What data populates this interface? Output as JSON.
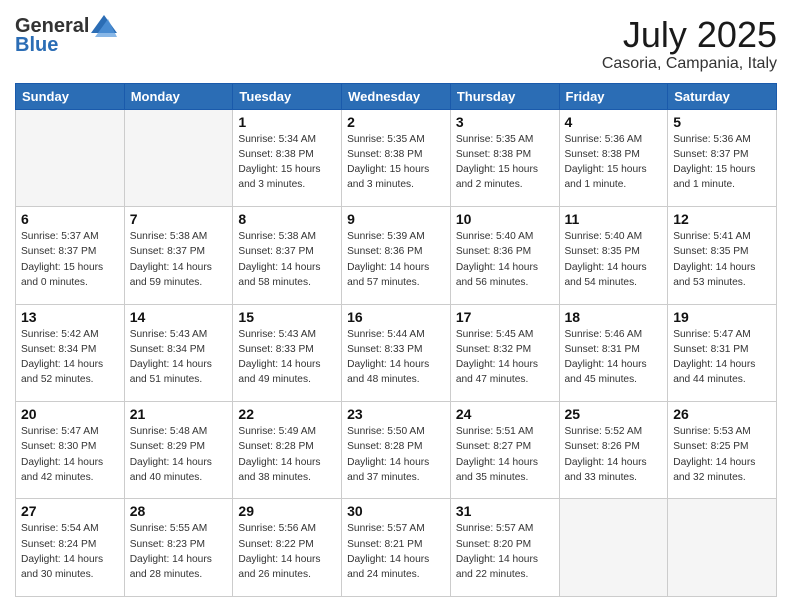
{
  "header": {
    "logo_general": "General",
    "logo_blue": "Blue",
    "month": "July 2025",
    "location": "Casoria, Campania, Italy"
  },
  "days_of_week": [
    "Sunday",
    "Monday",
    "Tuesday",
    "Wednesday",
    "Thursday",
    "Friday",
    "Saturday"
  ],
  "weeks": [
    [
      {
        "day": "",
        "info": ""
      },
      {
        "day": "",
        "info": ""
      },
      {
        "day": "1",
        "info": "Sunrise: 5:34 AM\nSunset: 8:38 PM\nDaylight: 15 hours\nand 3 minutes."
      },
      {
        "day": "2",
        "info": "Sunrise: 5:35 AM\nSunset: 8:38 PM\nDaylight: 15 hours\nand 3 minutes."
      },
      {
        "day": "3",
        "info": "Sunrise: 5:35 AM\nSunset: 8:38 PM\nDaylight: 15 hours\nand 2 minutes."
      },
      {
        "day": "4",
        "info": "Sunrise: 5:36 AM\nSunset: 8:38 PM\nDaylight: 15 hours\nand 1 minute."
      },
      {
        "day": "5",
        "info": "Sunrise: 5:36 AM\nSunset: 8:37 PM\nDaylight: 15 hours\nand 1 minute."
      }
    ],
    [
      {
        "day": "6",
        "info": "Sunrise: 5:37 AM\nSunset: 8:37 PM\nDaylight: 15 hours\nand 0 minutes."
      },
      {
        "day": "7",
        "info": "Sunrise: 5:38 AM\nSunset: 8:37 PM\nDaylight: 14 hours\nand 59 minutes."
      },
      {
        "day": "8",
        "info": "Sunrise: 5:38 AM\nSunset: 8:37 PM\nDaylight: 14 hours\nand 58 minutes."
      },
      {
        "day": "9",
        "info": "Sunrise: 5:39 AM\nSunset: 8:36 PM\nDaylight: 14 hours\nand 57 minutes."
      },
      {
        "day": "10",
        "info": "Sunrise: 5:40 AM\nSunset: 8:36 PM\nDaylight: 14 hours\nand 56 minutes."
      },
      {
        "day": "11",
        "info": "Sunrise: 5:40 AM\nSunset: 8:35 PM\nDaylight: 14 hours\nand 54 minutes."
      },
      {
        "day": "12",
        "info": "Sunrise: 5:41 AM\nSunset: 8:35 PM\nDaylight: 14 hours\nand 53 minutes."
      }
    ],
    [
      {
        "day": "13",
        "info": "Sunrise: 5:42 AM\nSunset: 8:34 PM\nDaylight: 14 hours\nand 52 minutes."
      },
      {
        "day": "14",
        "info": "Sunrise: 5:43 AM\nSunset: 8:34 PM\nDaylight: 14 hours\nand 51 minutes."
      },
      {
        "day": "15",
        "info": "Sunrise: 5:43 AM\nSunset: 8:33 PM\nDaylight: 14 hours\nand 49 minutes."
      },
      {
        "day": "16",
        "info": "Sunrise: 5:44 AM\nSunset: 8:33 PM\nDaylight: 14 hours\nand 48 minutes."
      },
      {
        "day": "17",
        "info": "Sunrise: 5:45 AM\nSunset: 8:32 PM\nDaylight: 14 hours\nand 47 minutes."
      },
      {
        "day": "18",
        "info": "Sunrise: 5:46 AM\nSunset: 8:31 PM\nDaylight: 14 hours\nand 45 minutes."
      },
      {
        "day": "19",
        "info": "Sunrise: 5:47 AM\nSunset: 8:31 PM\nDaylight: 14 hours\nand 44 minutes."
      }
    ],
    [
      {
        "day": "20",
        "info": "Sunrise: 5:47 AM\nSunset: 8:30 PM\nDaylight: 14 hours\nand 42 minutes."
      },
      {
        "day": "21",
        "info": "Sunrise: 5:48 AM\nSunset: 8:29 PM\nDaylight: 14 hours\nand 40 minutes."
      },
      {
        "day": "22",
        "info": "Sunrise: 5:49 AM\nSunset: 8:28 PM\nDaylight: 14 hours\nand 38 minutes."
      },
      {
        "day": "23",
        "info": "Sunrise: 5:50 AM\nSunset: 8:28 PM\nDaylight: 14 hours\nand 37 minutes."
      },
      {
        "day": "24",
        "info": "Sunrise: 5:51 AM\nSunset: 8:27 PM\nDaylight: 14 hours\nand 35 minutes."
      },
      {
        "day": "25",
        "info": "Sunrise: 5:52 AM\nSunset: 8:26 PM\nDaylight: 14 hours\nand 33 minutes."
      },
      {
        "day": "26",
        "info": "Sunrise: 5:53 AM\nSunset: 8:25 PM\nDaylight: 14 hours\nand 32 minutes."
      }
    ],
    [
      {
        "day": "27",
        "info": "Sunrise: 5:54 AM\nSunset: 8:24 PM\nDaylight: 14 hours\nand 30 minutes."
      },
      {
        "day": "28",
        "info": "Sunrise: 5:55 AM\nSunset: 8:23 PM\nDaylight: 14 hours\nand 28 minutes."
      },
      {
        "day": "29",
        "info": "Sunrise: 5:56 AM\nSunset: 8:22 PM\nDaylight: 14 hours\nand 26 minutes."
      },
      {
        "day": "30",
        "info": "Sunrise: 5:57 AM\nSunset: 8:21 PM\nDaylight: 14 hours\nand 24 minutes."
      },
      {
        "day": "31",
        "info": "Sunrise: 5:57 AM\nSunset: 8:20 PM\nDaylight: 14 hours\nand 22 minutes."
      },
      {
        "day": "",
        "info": ""
      },
      {
        "day": "",
        "info": ""
      }
    ]
  ]
}
